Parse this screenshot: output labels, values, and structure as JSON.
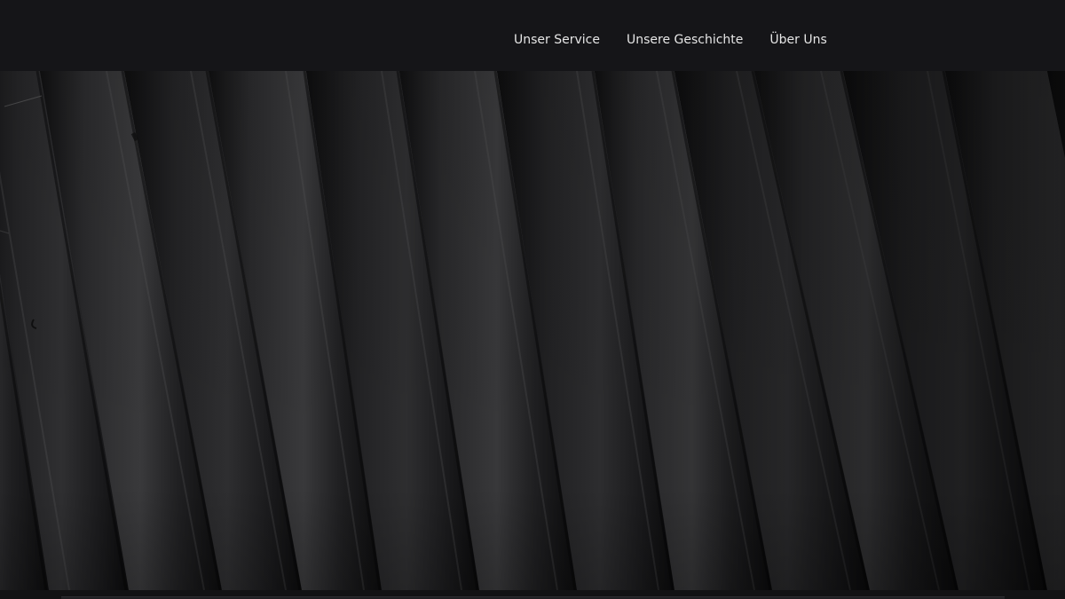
{
  "navigation": {
    "items": [
      {
        "label": "Unser Service"
      },
      {
        "label": "Unsere Geschichte"
      },
      {
        "label": "Über Uns"
      }
    ]
  },
  "colors": {
    "header_background": "#151518",
    "nav_text": "#e6e6e6",
    "hero_dark": "#111112",
    "hero_highlight": "#444446"
  },
  "hero": {
    "image_subject": "dark diagonal corrugated metal texture"
  }
}
